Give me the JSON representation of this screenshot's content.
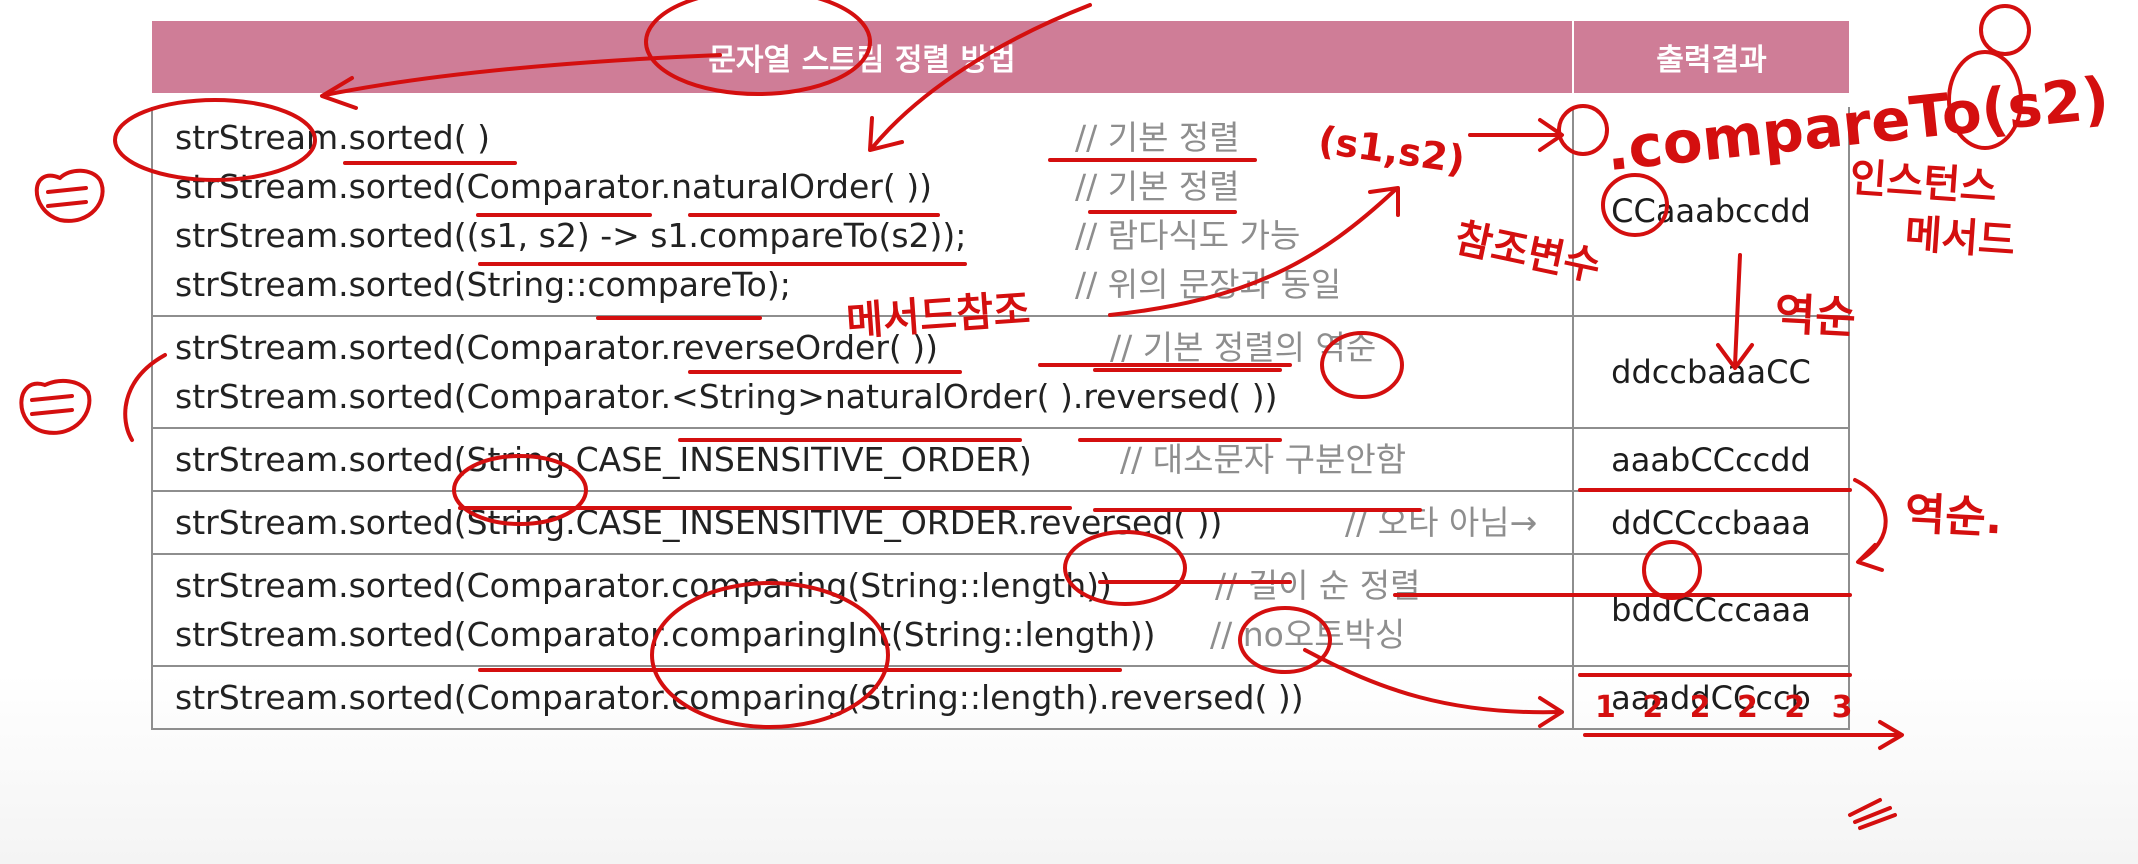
{
  "header": {
    "method_col": "문자열 스트림 정렬 방법",
    "output_col": "출력결과"
  },
  "rows": [
    {
      "lines": [
        {
          "code": "strStream.sorted( )",
          "comment": "// 기본 정렬"
        },
        {
          "code": "strStream.sorted(Comparator.naturalOrder( ))",
          "comment": "// 기본 정렬"
        },
        {
          "code": "strStream.sorted((s1, s2) -> s1.compareTo(s2));",
          "comment": "// 람다식도 가능"
        },
        {
          "code": "strStream.sorted(String::compareTo);",
          "comment": "// 위의 문장과 동일"
        }
      ],
      "output": "CCaaabccdd"
    },
    {
      "lines": [
        {
          "code": "strStream.sorted(Comparator.reverseOrder( ))",
          "comment": "// 기본 정렬의 역순"
        },
        {
          "code": "strStream.sorted(Comparator.<String>naturalOrder( ).reversed( ))",
          "comment": ""
        }
      ],
      "output": "ddccbaaaCC"
    },
    {
      "lines": [
        {
          "code": "strStream.sorted(String.CASE_INSENSITIVE_ORDER)",
          "comment": "// 대소문자 구분안함"
        }
      ],
      "output": "aaabCCccdd"
    },
    {
      "lines": [
        {
          "code": "strStream.sorted(String.CASE_INSENSITIVE_ORDER.reversed( ))",
          "comment": "// 오타 아님→"
        }
      ],
      "output": "ddCCccbaaa"
    },
    {
      "lines": [
        {
          "code": "strStream.sorted(Comparator.comparing(String::length))",
          "comment": "// 길이 순 정렬"
        },
        {
          "code": "strStream.sorted(Comparator.comparingInt(String::length))",
          "comment": "// no오토박싱"
        }
      ],
      "output": "bddCCccaaa"
    },
    {
      "lines": [
        {
          "code": "strStream.sorted(Comparator.comparing(String::length).reversed( ))",
          "comment": ""
        }
      ],
      "output": "aaaddCCccb"
    }
  ],
  "annotations": {
    "method_ref": "메서드참조",
    "lambda_args": "(s1,s2)",
    "compare_expr": ".compareTo(s2)",
    "instance_method": "인스턴스",
    "method_word": "메서드",
    "reverse_1": "역순",
    "reverse_2": "역순.",
    "ref_var": "참조변수",
    "length_marks": "1 2 2 2 2 3"
  }
}
